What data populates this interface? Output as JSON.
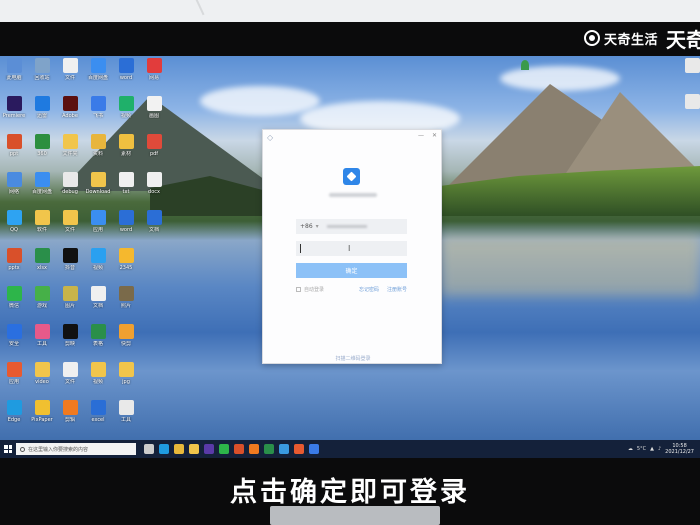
{
  "watermark": {
    "brand": "天奇生活",
    "big": "天奇"
  },
  "dialog": {
    "country_code": "+86",
    "confirm_label": "确定",
    "remember_label": "自动登录",
    "link_left": "忘记密码",
    "link_right": "注册账号",
    "footer": "扫描二维码登录"
  },
  "taskbar": {
    "search_placeholder": "在这里输入你要搜索的内容",
    "tray_temp": "5°C",
    "time": "10:58",
    "date": "2021/12/27"
  },
  "caption": "点击确定即可登录",
  "desktop_icons": [
    {
      "label": "此电脑",
      "color": "#5b8ed6"
    },
    {
      "label": "回收站",
      "color": "#7fa3c9"
    },
    {
      "label": "文件",
      "color": "#f0f0f0"
    },
    {
      "label": "百度网盘",
      "color": "#3b8ef0"
    },
    {
      "label": "word",
      "color": "#2b6ed6"
    },
    {
      "label": "网易",
      "color": "#e23c3c"
    },
    {
      "label": "Premiere",
      "color": "#2a1a5e"
    },
    {
      "label": "迅雷",
      "color": "#1f7ae0"
    },
    {
      "label": "Adobe",
      "color": "#5b1010"
    },
    {
      "label": "飞书",
      "color": "#3a7be8"
    },
    {
      "label": "视频",
      "color": "#1fb06a"
    },
    {
      "label": "画图",
      "color": "#f2f2f2"
    },
    {
      "label": "ppt",
      "color": "#d9502a"
    },
    {
      "label": "360",
      "color": "#2d8f3f"
    },
    {
      "label": "文件夹",
      "color": "#f1c54b"
    },
    {
      "label": "资料",
      "color": "#e8b53c"
    },
    {
      "label": "素材",
      "color": "#f0c040"
    },
    {
      "label": "pdf",
      "color": "#e04a3a"
    },
    {
      "label": "网络",
      "color": "#4a8be0"
    },
    {
      "label": "百度网盘",
      "color": "#3b8ef0"
    },
    {
      "label": "debug",
      "color": "#e9e9e9"
    },
    {
      "label": "Download",
      "color": "#f1c54b"
    },
    {
      "label": "txt",
      "color": "#f0f0f0"
    },
    {
      "label": "docx",
      "color": "#f0f0f0"
    },
    {
      "label": "QQ",
      "color": "#2ea3f2"
    },
    {
      "label": "软件",
      "color": "#f1c54b"
    },
    {
      "label": "文件",
      "color": "#f1c54b"
    },
    {
      "label": "应用",
      "color": "#3b8ef0"
    },
    {
      "label": "word",
      "color": "#2b6ed6"
    },
    {
      "label": "文档",
      "color": "#2b6ed6"
    },
    {
      "label": "pptx",
      "color": "#d9502a"
    },
    {
      "label": "xlsx",
      "color": "#2a8f4a"
    },
    {
      "label": "抖音",
      "color": "#111111"
    },
    {
      "label": "视频",
      "color": "#2aa0f0"
    },
    {
      "label": "2345",
      "color": "#f5b82e"
    },
    {
      "label": "",
      "color": "#00000000"
    },
    {
      "label": "微信",
      "color": "#2db54a"
    },
    {
      "label": "游戏",
      "color": "#46b048"
    },
    {
      "label": "图片",
      "color": "#c8b44a"
    },
    {
      "label": "文档",
      "color": "#f0f0f0"
    },
    {
      "label": "照片",
      "color": "#7a6a4a"
    },
    {
      "label": "",
      "color": "#00000000"
    },
    {
      "label": "安全",
      "color": "#2a6fe0"
    },
    {
      "label": "工具",
      "color": "#e65a8a"
    },
    {
      "label": "剪映",
      "color": "#111111"
    },
    {
      "label": "表格",
      "color": "#2a8f4a"
    },
    {
      "label": "快剪",
      "color": "#f0a030"
    },
    {
      "label": "",
      "color": "#00000000"
    },
    {
      "label": "应用",
      "color": "#e85a30"
    },
    {
      "label": "video",
      "color": "#f1c54b"
    },
    {
      "label": "文件",
      "color": "#f0f0f0"
    },
    {
      "label": "视频",
      "color": "#f1c54b"
    },
    {
      "label": "jpg",
      "color": "#f1c54b"
    },
    {
      "label": "",
      "color": "#00000000"
    },
    {
      "label": "Edge",
      "color": "#1f9be0"
    },
    {
      "label": "PixPaper",
      "color": "#f0c030"
    },
    {
      "label": "剪辑",
      "color": "#f07a20"
    },
    {
      "label": "excel",
      "color": "#2a6ed6"
    },
    {
      "label": "工具",
      "color": "#e9e9e9"
    },
    {
      "label": "",
      "color": "#00000000"
    }
  ],
  "taskbar_icons": [
    {
      "name": "task-view",
      "color": "#cccccc"
    },
    {
      "name": "edge",
      "color": "#1f9be0"
    },
    {
      "name": "chrome",
      "color": "#e8b83a"
    },
    {
      "name": "explorer",
      "color": "#f1c54b"
    },
    {
      "name": "pr",
      "color": "#5a3aa8"
    },
    {
      "name": "wechat",
      "color": "#2db54a"
    },
    {
      "name": "wps",
      "color": "#d9502a"
    },
    {
      "name": "app",
      "color": "#f07a20"
    },
    {
      "name": "excel",
      "color": "#2a8f4a"
    },
    {
      "name": "photo",
      "color": "#3a9ae0"
    },
    {
      "name": "store",
      "color": "#e85a30"
    },
    {
      "name": "feishu",
      "color": "#3a7be8"
    }
  ]
}
